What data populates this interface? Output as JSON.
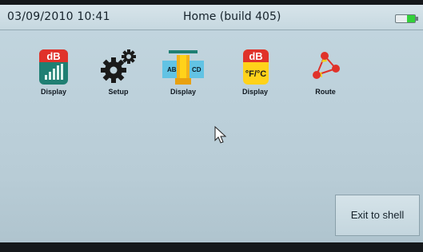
{
  "status_bar": {
    "datetime": "03/09/2010 10:41",
    "title": "Home (build 405)",
    "battery_icon": "battery-icon"
  },
  "apps": [
    {
      "icon": "db-level-meter-icon",
      "label": "Display"
    },
    {
      "icon": "gears-icon",
      "label": "Setup"
    },
    {
      "icon": "ab-cd-valve-icon",
      "label": "Display",
      "icon_text_left": "AB",
      "icon_text_right": "CD"
    },
    {
      "icon": "db-temperature-icon",
      "label": "Display",
      "icon_text_top": "dB",
      "icon_text_bottom": "°F/°C"
    },
    {
      "icon": "route-icon",
      "label": "Route"
    }
  ],
  "app0_icon_text": "dB",
  "exit_button": {
    "label": "Exit to shell"
  },
  "colors": {
    "background": "#bdd1db",
    "title_bar": "#cfdfe6",
    "battery_fill": "#33d13a",
    "db_icon_red": "#e0322a",
    "db_icon_teal": "#1f7f73",
    "temp_icon_yellow": "#ffd21a",
    "route_red": "#e0322a",
    "route_yellow": "#f2d21b"
  }
}
